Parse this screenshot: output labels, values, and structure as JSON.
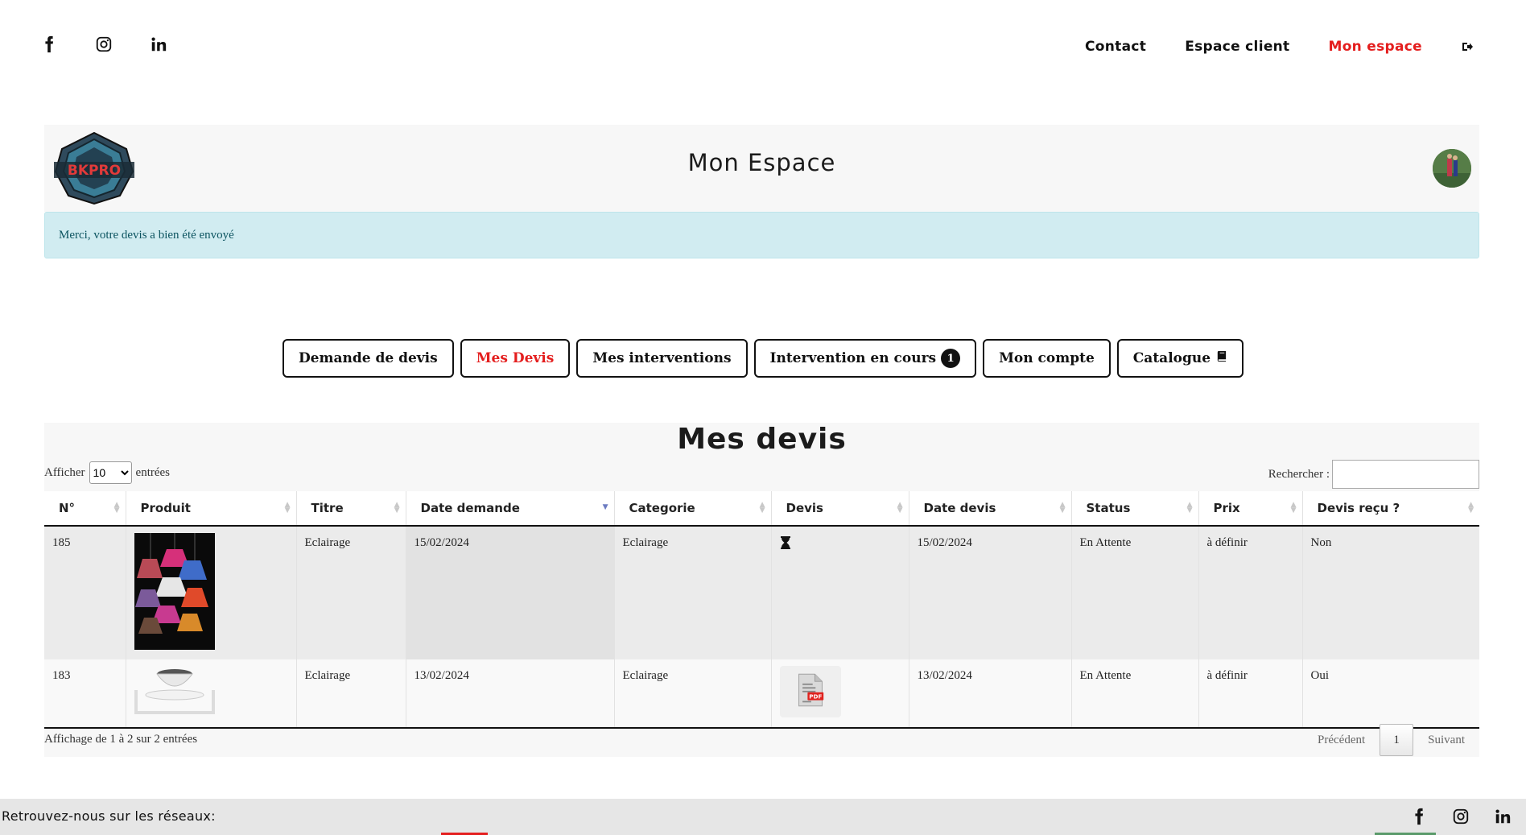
{
  "topnav": {
    "contact": "Contact",
    "espace_client": "Espace client",
    "mon_espace": "Mon espace"
  },
  "header": {
    "title": "Mon Espace",
    "logo_text": "BKPRO"
  },
  "alert": {
    "message": "Merci, votre devis a bien été envoyé"
  },
  "tabs": [
    {
      "label": "Demande de devis"
    },
    {
      "label": "Mes Devis"
    },
    {
      "label": "Mes interventions"
    },
    {
      "label": "Intervention en cours",
      "badge": "1"
    },
    {
      "label": "Mon compte"
    },
    {
      "label": "Catalogue"
    }
  ],
  "table": {
    "title": "Mes devis",
    "length_prefix": "Afficher",
    "length_value": "10",
    "length_suffix": "entrées",
    "search_label": "Rechercher :",
    "columns": [
      "N°",
      "Produit",
      "Titre",
      "Date demande",
      "Categorie",
      "Devis",
      "Date devis",
      "Status",
      "Prix",
      "Devis reçu ?"
    ],
    "rows": [
      {
        "num": "185",
        "titre": "Eclairage",
        "date_demande": "15/02/2024",
        "categorie": "Eclairage",
        "devis_icon": "hourglass-icon",
        "date_devis": "15/02/2024",
        "status": "En Attente",
        "prix": "à définir",
        "recu": "Non"
      },
      {
        "num": "183",
        "titre": "Eclairage",
        "date_demande": "13/02/2024",
        "categorie": "Eclairage",
        "devis_icon": "pdf-icon",
        "date_devis": "13/02/2024",
        "status": "En Attente",
        "prix": "à définir",
        "recu": "Oui"
      }
    ],
    "info": "Affichage de 1 à 2 sur 2 entrées",
    "prev": "Précédent",
    "current_page": "1",
    "next": "Suivant"
  },
  "footer": {
    "text": "Retrouvez-nous sur les réseaux:"
  },
  "colors": {
    "accent": "#e41e1e",
    "alert_bg": "#d1ecf1",
    "alert_text": "#0c5460"
  }
}
